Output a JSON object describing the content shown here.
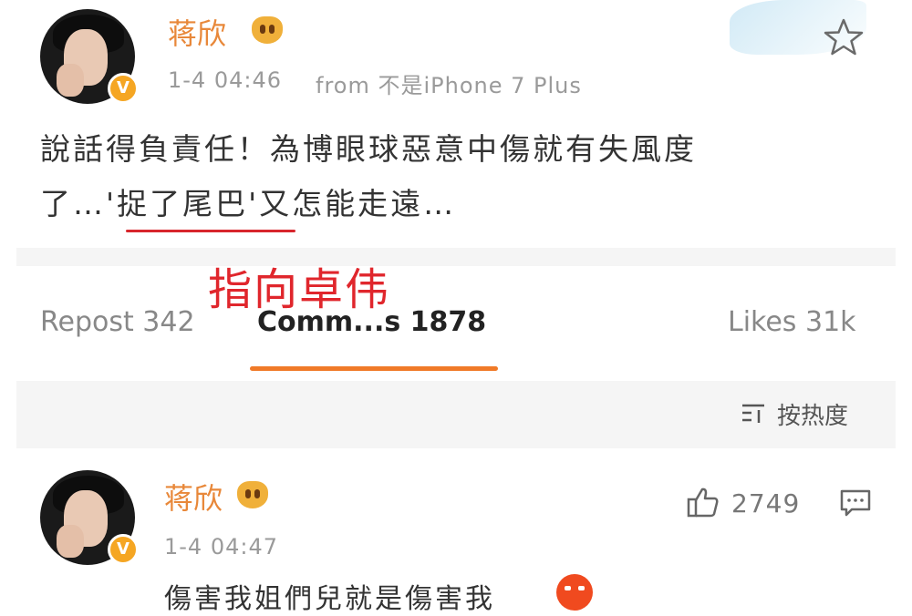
{
  "post": {
    "username": "蒋欣",
    "date": "1-4 04:46",
    "from_text": "from 不是iPhone 7 Plus",
    "text_line1": "說話得負責任！為博眼球惡意中傷就有失風度",
    "text_line2_pre": "了…",
    "text_line2_highlight": "'捉了尾巴'",
    "text_line2_post": "又怎能走遠…",
    "verified_badge": "V"
  },
  "annotation": {
    "text": "指向卓伟",
    "color": "#e0262c"
  },
  "stats": {
    "repost_label": "Repost 342",
    "comments_label": "Comm...s 1878",
    "likes_label": "Likes 31k"
  },
  "sort": {
    "label": "按热度",
    "icon": "sort-icon"
  },
  "comment": {
    "username": "蒋欣",
    "date": "1-4 04:47",
    "like_count": "2749",
    "text": "傷害我姐們兒就是傷害我",
    "verified_badge": "V"
  },
  "colors": {
    "username": "#e8883a",
    "active_tab_bar": "#f07a28",
    "annotation_underline": "#d8262c"
  }
}
